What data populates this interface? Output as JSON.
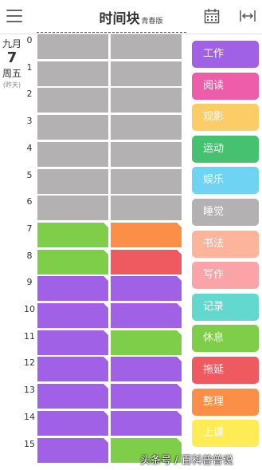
{
  "header": {
    "title": "时间块",
    "edition": "青春版"
  },
  "date": {
    "month": "九月",
    "day": "7",
    "weekday": "周五",
    "relative": "(昨天)"
  },
  "hours": [
    "0",
    "1",
    "2",
    "3",
    "4",
    "5",
    "6",
    "7",
    "8",
    "9",
    "10",
    "11",
    "12",
    "13",
    "14",
    "15"
  ],
  "categories": [
    {
      "label": "工作",
      "color": "#a061e6"
    },
    {
      "label": "阅读",
      "color": "#ee5ea8"
    },
    {
      "label": "观影",
      "color": "#fccd66"
    },
    {
      "label": "运动",
      "color": "#46c170"
    },
    {
      "label": "娱乐",
      "color": "#6fd3f3"
    },
    {
      "label": "睡觉",
      "color": "#b3b1b1"
    },
    {
      "label": "书法",
      "color": "#fcb59a"
    },
    {
      "label": "写作",
      "color": "#fba4a8"
    },
    {
      "label": "记录",
      "color": "#62d8ce"
    },
    {
      "label": "休息",
      "color": "#7fce4a"
    },
    {
      "label": "拖延",
      "color": "#ee5a5f"
    },
    {
      "label": "整理",
      "color": "#fb8f48"
    },
    {
      "label": "上课",
      "color": "#fdec55"
    }
  ],
  "schedule": [
    [
      "睡觉",
      "睡觉"
    ],
    [
      "睡觉",
      "睡觉"
    ],
    [
      "睡觉",
      "睡觉"
    ],
    [
      "睡觉",
      "睡觉"
    ],
    [
      "睡觉",
      "睡觉"
    ],
    [
      "睡觉",
      "睡觉"
    ],
    [
      "睡觉",
      "睡觉"
    ],
    [
      "休息",
      "整理"
    ],
    [
      "休息",
      "拖延"
    ],
    [
      "工作",
      "工作"
    ],
    [
      "工作",
      "工作"
    ],
    [
      "工作",
      "休息"
    ],
    [
      "工作",
      "工作"
    ],
    [
      "工作",
      "工作"
    ],
    [
      "工作",
      "工作"
    ],
    [
      "工作",
      "休息"
    ]
  ],
  "watermark": "头条号 / 百科普普说"
}
